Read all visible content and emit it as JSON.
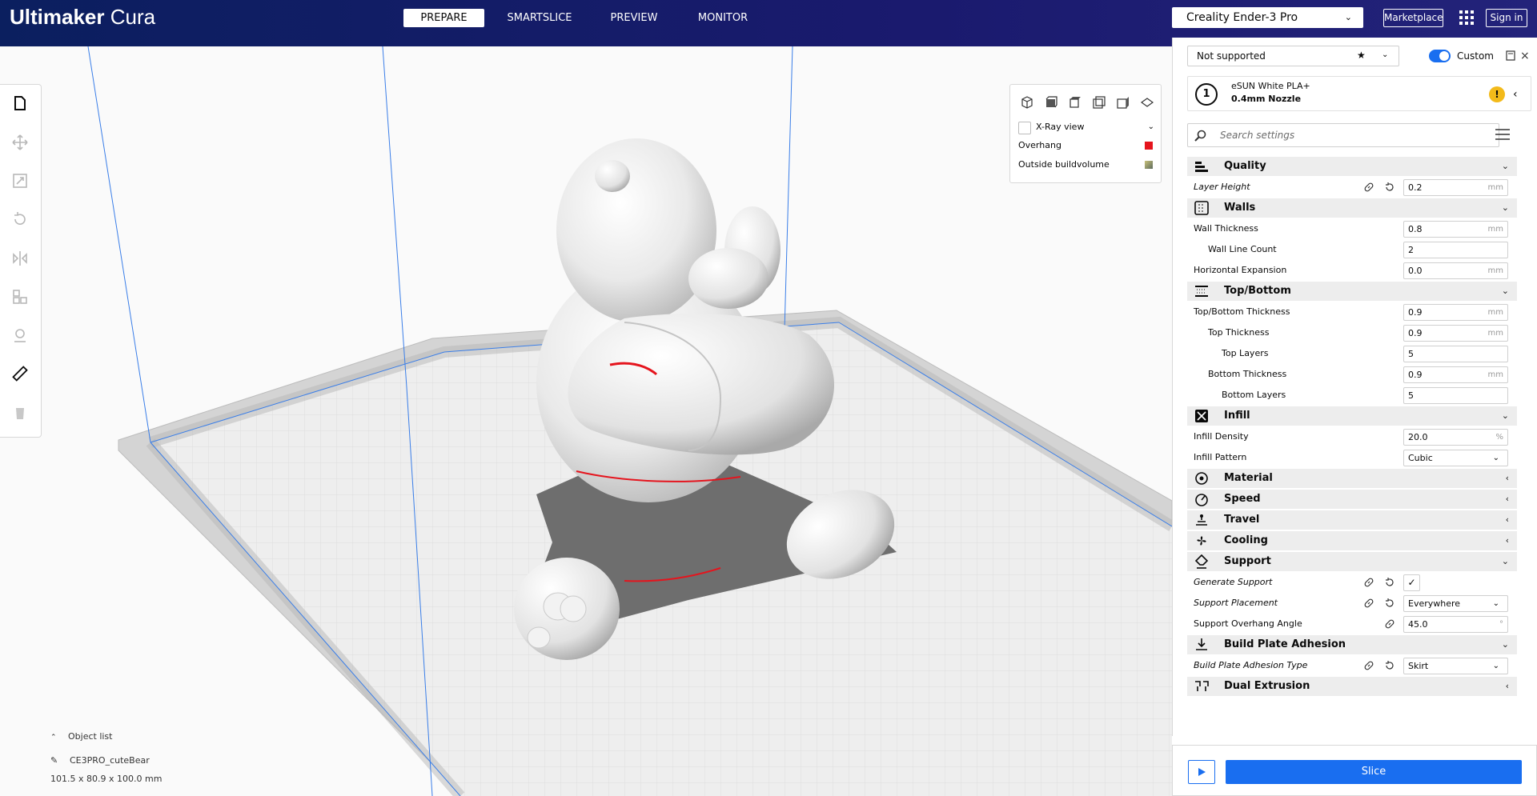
{
  "header": {
    "logo_bold": "Ultimaker",
    "logo_light": "Cura",
    "tabs": [
      {
        "label": "PREPARE",
        "active": true
      },
      {
        "label": "SMARTSLICE",
        "active": false
      },
      {
        "label": "PREVIEW",
        "active": false
      },
      {
        "label": "MONITOR",
        "active": false
      }
    ],
    "printer": "Creality Ender-3 Pro",
    "marketplace_label": "Marketplace",
    "signin_label": "Sign in"
  },
  "view_panel": {
    "xray_label": "X-Ray view",
    "legend": [
      {
        "label": "Overhang",
        "color": "#e5141d"
      },
      {
        "label": "Outside buildvolume",
        "color": "#8a8a5a"
      }
    ],
    "view_icons": [
      "3d-view-icon",
      "front-view-icon",
      "top-view-icon",
      "left-view-icon",
      "right-view-icon",
      "perspective-toggle-icon"
    ]
  },
  "left_toolbar": {
    "tools": [
      "open-file-icon",
      "move-icon",
      "scale-icon",
      "rotate-icon",
      "mirror-icon",
      "per-model-settings-icon",
      "support-blocker-icon",
      "measure-icon",
      "delete-icon"
    ]
  },
  "object_list": {
    "title": "Object list",
    "object_name": "CE3PRO_cuteBear",
    "dimensions": "101.5 x 80.9 x 100.0 mm"
  },
  "settings": {
    "profile": "Not supported",
    "custom_label": "Custom",
    "extruder_number": "1",
    "material": "eSUN White PLA+",
    "nozzle": "0.4mm Nozzle",
    "search_placeholder": "Search settings",
    "categories": {
      "quality": "Quality",
      "walls": "Walls",
      "topbottom": "Top/Bottom",
      "infill": "Infill",
      "material": "Material",
      "speed": "Speed",
      "travel": "Travel",
      "cooling": "Cooling",
      "support": "Support",
      "adhesion": "Build Plate Adhesion",
      "dual": "Dual Extrusion"
    },
    "rows": {
      "layer_height": {
        "label": "Layer Height",
        "value": "0.2",
        "unit": "mm"
      },
      "wall_thickness": {
        "label": "Wall Thickness",
        "value": "0.8",
        "unit": "mm"
      },
      "wall_line_count": {
        "label": "Wall Line Count",
        "value": "2"
      },
      "horizontal_expansion": {
        "label": "Horizontal Expansion",
        "value": "0.0",
        "unit": "mm"
      },
      "tb_thickness": {
        "label": "Top/Bottom Thickness",
        "value": "0.9",
        "unit": "mm"
      },
      "top_thickness": {
        "label": "Top Thickness",
        "value": "0.9",
        "unit": "mm"
      },
      "top_layers": {
        "label": "Top Layers",
        "value": "5"
      },
      "bottom_thickness": {
        "label": "Bottom Thickness",
        "value": "0.9",
        "unit": "mm"
      },
      "bottom_layers": {
        "label": "Bottom Layers",
        "value": "5"
      },
      "infill_density": {
        "label": "Infill Density",
        "value": "20.0",
        "unit": "%"
      },
      "infill_pattern": {
        "label": "Infill Pattern",
        "value": "Cubic"
      },
      "generate_support": {
        "label": "Generate Support",
        "value": "✓"
      },
      "support_placement": {
        "label": "Support Placement",
        "value": "Everywhere"
      },
      "overhang_angle": {
        "label": "Support Overhang Angle",
        "value": "45.0",
        "unit": "°"
      },
      "adhesion_type": {
        "label": "Build Plate Adhesion Type",
        "value": "Skirt"
      }
    }
  },
  "slice": {
    "label": "Slice"
  },
  "colors": {
    "header_bg": "#0b1f5f",
    "accent": "#196ef0",
    "overhang": "#e5141d",
    "warning": "#f3ba1a"
  }
}
